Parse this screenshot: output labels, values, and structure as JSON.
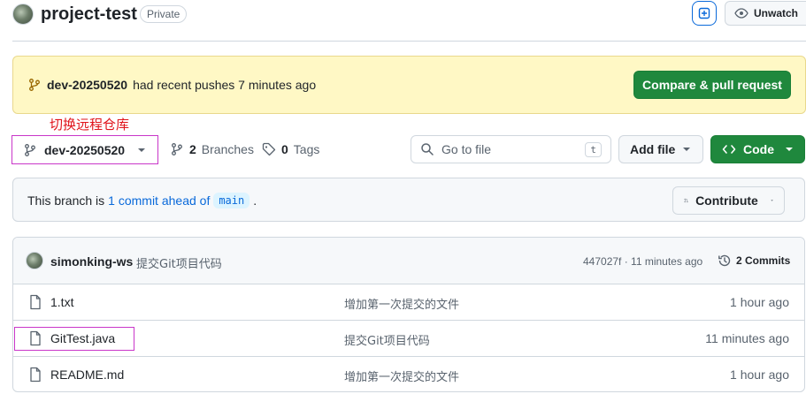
{
  "header": {
    "repo_name": "project-test",
    "visibility": "Private",
    "watch_label": "Unwatch"
  },
  "banner": {
    "branch": "dev-20250520",
    "message": "had recent pushes 7 minutes ago",
    "compare_label": "Compare & pull request"
  },
  "annotation": "切换远程仓库",
  "toolbar": {
    "current_branch": "dev-20250520",
    "branches_count": "2",
    "branches_label": "Branches",
    "tags_count": "0",
    "tags_label": "Tags",
    "goto_placeholder": "Go to file",
    "goto_shortcut": "t",
    "add_file_label": "Add file",
    "code_label": "Code"
  },
  "ahead": {
    "prefix": "This branch is",
    "link": "1 commit ahead of",
    "base": "main",
    "suffix": ".",
    "contribute_label": "Contribute"
  },
  "latest_commit": {
    "author": "simonking-ws",
    "message": "提交Git项目代码",
    "hash_time": "447027f · 11 minutes ago",
    "commits_label": "2 Commits"
  },
  "files": [
    {
      "name": "1.txt",
      "message": "增加第一次提交的文件",
      "time": "1 hour ago"
    },
    {
      "name": "GitTest.java",
      "message": "提交Git项目代码",
      "time": "11 minutes ago"
    },
    {
      "name": "README.md",
      "message": "增加第一次提交的文件",
      "time": "1 hour ago"
    }
  ],
  "colors": {
    "accent": "#0969da",
    "primary_green": "#1f883d",
    "banner_bg": "#fff8c5",
    "annotation_red": "#e0131a",
    "highlight_magenta": "#c936c9"
  }
}
